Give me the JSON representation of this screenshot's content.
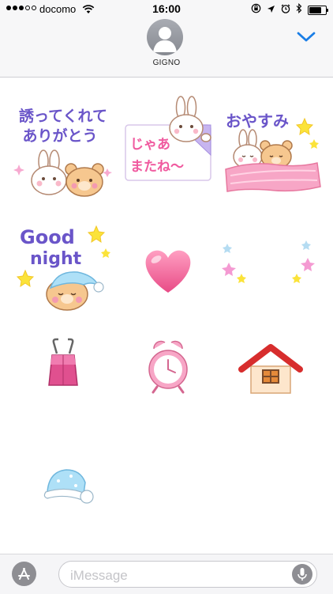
{
  "status_bar": {
    "carrier": "docomo",
    "time": "16:00",
    "signal_bars_filled": 3,
    "signal_bars_total": 5,
    "battery_level": 0.85
  },
  "header": {
    "contact_name": "GIGNO",
    "expand_icon": "chevron-down-icon"
  },
  "stickers": [
    {
      "id": "thanks-for-inviting",
      "text_lines": [
        "誘ってくれて",
        "ありがとう"
      ]
    },
    {
      "id": "see-you",
      "text_lines": [
        "じゃあ",
        "またね〜"
      ]
    },
    {
      "id": "good-night-jp",
      "text": "おやすみ"
    },
    {
      "id": "good-night-en",
      "text_lines": [
        "Good",
        "night"
      ]
    },
    {
      "id": "pink-heart"
    },
    {
      "id": "stars-frame"
    },
    {
      "id": "binder-clip"
    },
    {
      "id": "alarm-clock"
    },
    {
      "id": "house"
    },
    {
      "id": "sleeping-cap"
    }
  ],
  "input": {
    "placeholder": "iMessage",
    "app_button_icon": "app-store-icon",
    "mic_icon": "microphone-icon"
  },
  "colors": {
    "accent_blue": "#1a7ee6",
    "sticker_pink": "#f05a9f",
    "sticker_purple": "#6a55c9",
    "star_yellow": "#fbe33a",
    "bar_background": "#f7f7f8"
  }
}
